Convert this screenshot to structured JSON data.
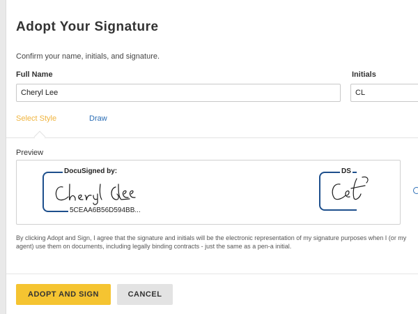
{
  "dialog": {
    "title": "Adopt Your Signature",
    "subtitle": "Confirm your name, initials, and signature."
  },
  "fields": {
    "full_name_label": "Full Name",
    "full_name_value": "Cheryl Lee",
    "initials_label": "Initials",
    "initials_value": "CL"
  },
  "tabs": [
    {
      "label": "Select Style",
      "active": true
    },
    {
      "label": "Draw",
      "active": false
    }
  ],
  "preview": {
    "label": "Preview",
    "signature_header": "DocuSigned by:",
    "signature_text": "Cheryl Lee",
    "signature_id": "5CEAA6B56D594BB...",
    "initials_header": "DS",
    "initials_text": "CL"
  },
  "disclaimer": "By clicking Adopt and Sign, I agree that the signature and initials will be the electronic representation of my signature purposes when I (or my agent) use them on documents, including legally binding contracts - just the same as a pen-a initial.",
  "buttons": {
    "adopt": "ADOPT AND SIGN",
    "cancel": "CANCEL"
  },
  "colors": {
    "accent_yellow": "#f5c431",
    "active_tab": "#f0b43e",
    "link_blue": "#2a6db5",
    "docusign_frame": "#1d4f8c"
  }
}
